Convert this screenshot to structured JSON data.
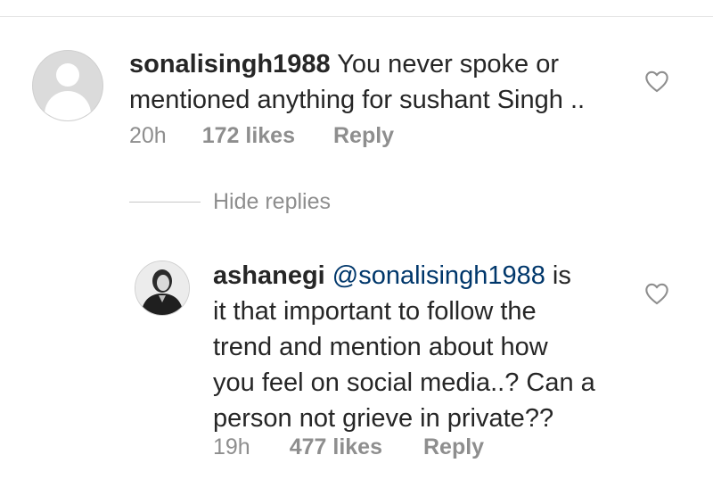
{
  "comments": [
    {
      "username": "sonalisingh1988",
      "text_line1": " You never spoke or",
      "text_line2": "mentioned anything for sushant Singh ..",
      "time": "20h",
      "likes": "172 likes",
      "reply": "Reply",
      "icon": "heart-outline-icon"
    }
  ],
  "hide_replies": "Hide replies",
  "replies": [
    {
      "username": "ashanegi",
      "mention": "@sonalisingh1988",
      "text_line1_tail": " is",
      "text_line2": "it that important to follow the",
      "text_line3": "trend and mention about how",
      "text_line4": "you feel on social media..? Can a",
      "text_line5": "person not grieve in private??",
      "time": "19h",
      "likes": "477 likes",
      "reply": "Reply",
      "icon": "heart-outline-icon"
    }
  ],
  "colors": {
    "text": "#262626",
    "meta": "#8e8e8e",
    "mention": "#00376b",
    "background": "#ffffff"
  }
}
